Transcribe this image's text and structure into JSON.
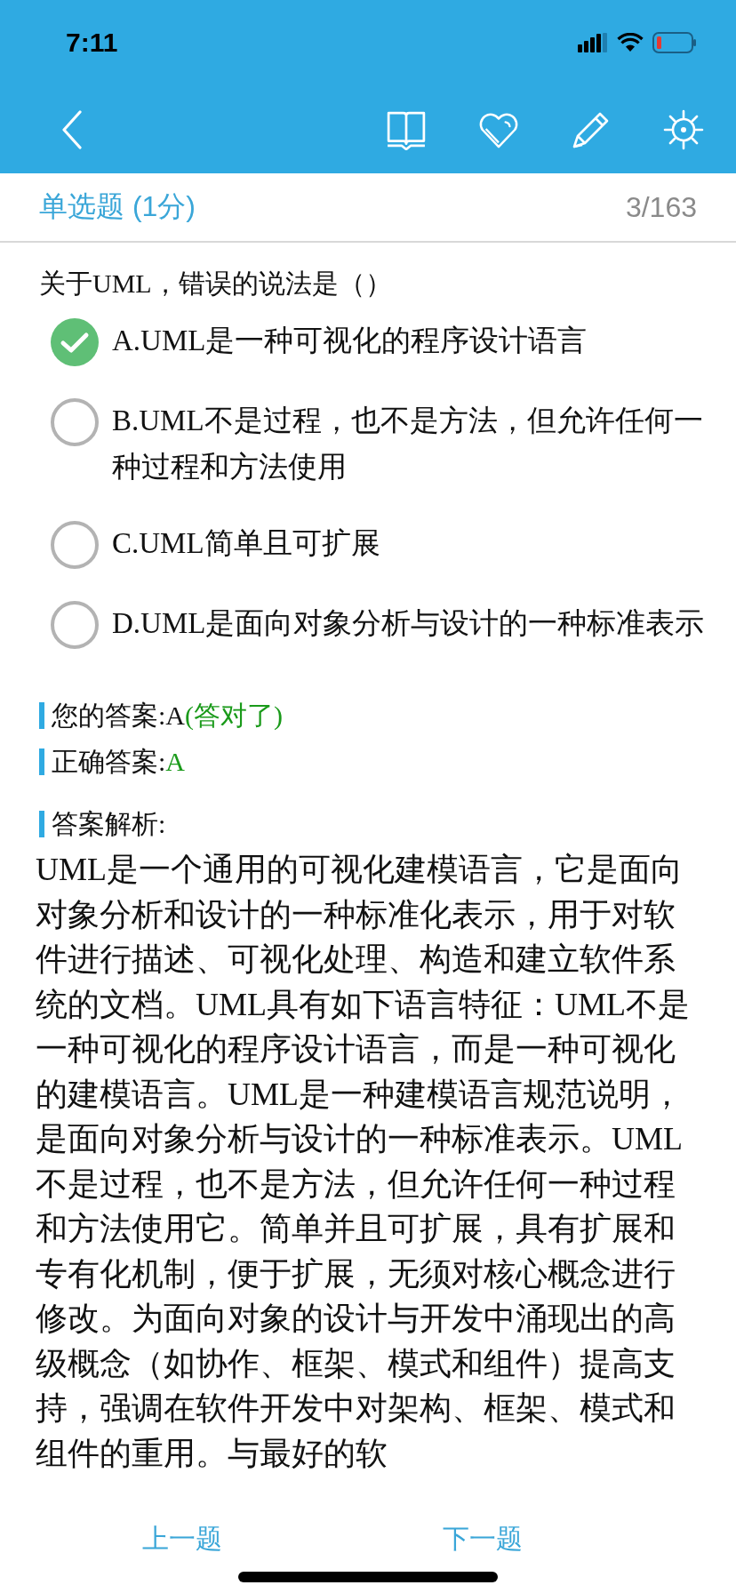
{
  "status_bar": {
    "time": "7:11"
  },
  "header": {
    "type": "单选题 (1分)",
    "progress": "3/163"
  },
  "question": {
    "text": "关于UML，错误的说法是（）",
    "options": [
      {
        "text": "A.UML是一种可视化的程序设计语言",
        "selected": true
      },
      {
        "text": "B.UML不是过程，也不是方法，但允许任何一种过程和方法使用",
        "selected": false
      },
      {
        "text": "C.UML简单且可扩展",
        "selected": false
      },
      {
        "text": "D.UML是面向对象分析与设计的一种标准表示",
        "selected": false
      }
    ]
  },
  "answers": [
    {
      "label": "您的答案:A",
      "note": "(答对了)"
    },
    {
      "label": "正确答案:",
      "note": "A"
    }
  ],
  "explanation": {
    "title": "答案解析:",
    "text": "UML是一个通用的可视化建模语言，它是面向对象分析和设计的一种标准化表示，用于对软件进行描述、可视化处理、构造和建立软件系统的文档。UML具有如下语言特征：UML不是一种可视化的程序设计语言，而是一种可视化的建模语言。UML是一种建模语言规范说明，是面向对象分析与设计的一种标准表示。UML不是过程，也不是方法，但允许任何一种过程和方法使用它。简单并且可扩展，具有扩展和专有化机制，便于扩展，无须对核心概念进行修改。为面向对象的设计与开发中涌现出的高级概念（如协作、框架、模式和组件）提高支持，强调在软件开发中对架构、框架、模式和组件的重用。与最好的软"
  },
  "footer": {
    "prev": "上一题",
    "next": "下一题"
  }
}
